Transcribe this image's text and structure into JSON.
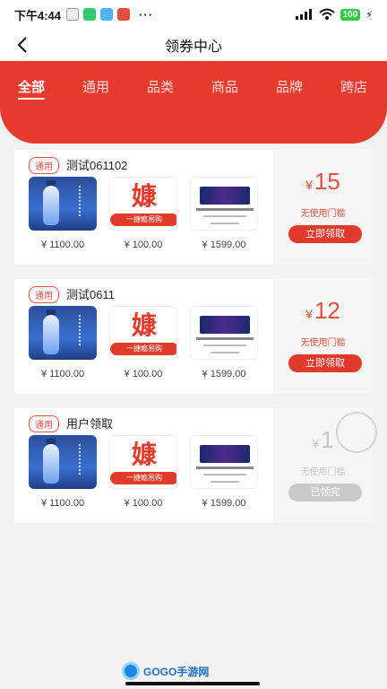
{
  "status": {
    "time": "下午4:44",
    "battery": "100"
  },
  "nav": {
    "title": "领券中心"
  },
  "tabs": [
    "全部",
    "通用",
    "品类",
    "商品",
    "品牌",
    "跨店"
  ],
  "coupons": [
    {
      "badge": "通用",
      "name": "测试061102",
      "products": [
        {
          "price": "¥ 1100.00"
        },
        {
          "price": "¥ 100.00"
        },
        {
          "price": "¥ 1599.00"
        }
      ],
      "currency": "¥",
      "amount": "15",
      "condition": "无使用门槛",
      "button": "立即领取",
      "claimed": false
    },
    {
      "badge": "通用",
      "name": "测试0611",
      "products": [
        {
          "price": "¥ 1100.00"
        },
        {
          "price": "¥ 100.00"
        },
        {
          "price": "¥ 1599.00"
        }
      ],
      "currency": "¥",
      "amount": "12",
      "condition": "无使用门槛",
      "button": "立即领取",
      "claimed": false
    },
    {
      "badge": "通用",
      "name": "用户领取",
      "products": [
        {
          "price": "¥ 1100.00"
        },
        {
          "price": "¥ 100.00"
        },
        {
          "price": "¥ 1599.00"
        }
      ],
      "currency": "¥",
      "amount": "1",
      "condition": "无使用门槛",
      "button": "已领完",
      "claimed": true
    }
  ],
  "product_images": {
    "logo_mark": "嫝",
    "logo_bar": "一捷瘾易购"
  },
  "watermark": {
    "text": "GOGO手游网"
  },
  "colors": {
    "accent": "#e63a2e",
    "disabled": "#c9c9c9"
  }
}
